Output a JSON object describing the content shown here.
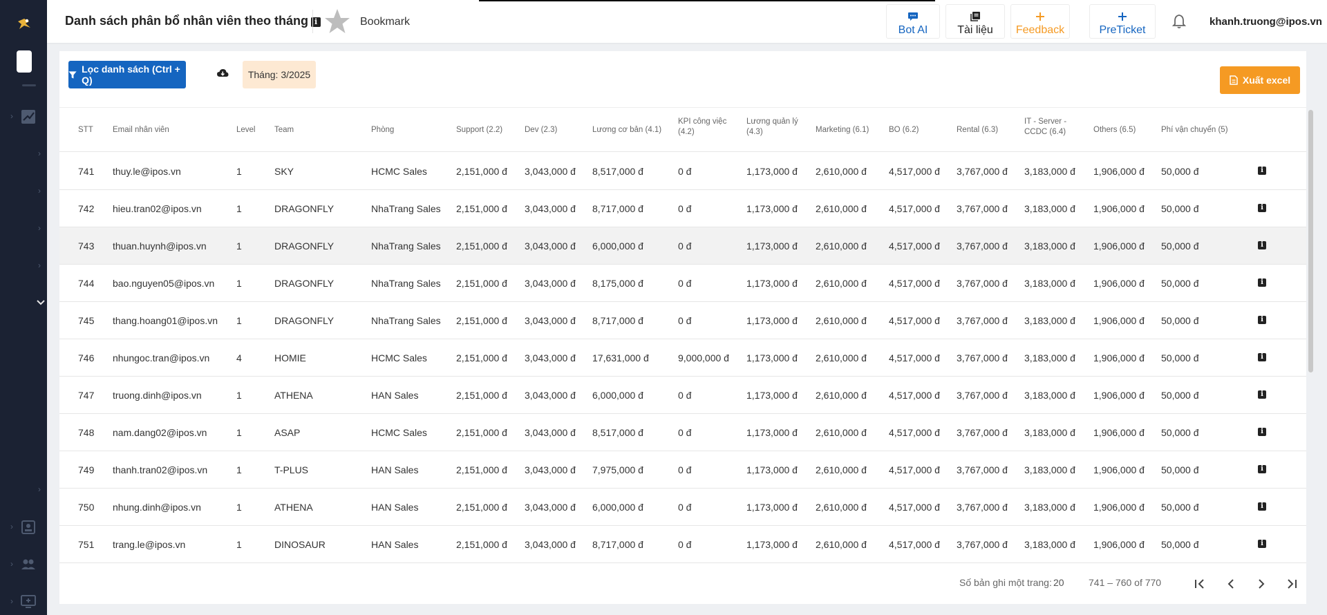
{
  "header": {
    "title": "Danh sách phân bổ nhân viên theo tháng",
    "info_glyph": "i",
    "bookmark_label": "Bookmark",
    "buttons": [
      {
        "label": "Bot AI",
        "icon": "chat-icon",
        "color": "#1565c0"
      },
      {
        "label": "Tài liệu",
        "icon": "library-icon",
        "color": "#222222"
      },
      {
        "label": "Feedback",
        "icon": "plus-icon",
        "color": "#f59a23"
      },
      {
        "label": "PreTicket",
        "icon": "plus-icon",
        "color": "#1565c0"
      }
    ],
    "user": "khanh.truong@ipos.vn"
  },
  "toolbar": {
    "filter_label": "Lọc danh sách (Ctrl + Q)",
    "month_label": "Tháng: 3/2025",
    "export_label": "Xuất excel"
  },
  "colors": {
    "sidebar": "#1b2233",
    "primary": "#1565c0",
    "accent": "#f59a23",
    "chip": "#fde9d3"
  },
  "table": {
    "columns": [
      "STT",
      "Email nhân viên",
      "Level",
      "Team",
      "Phòng",
      "Support (2.2)",
      "Dev (2.3)",
      "Lương cơ bản (4.1)",
      [
        "KPI công việc",
        "(4.2)"
      ],
      [
        "Lương quản lý",
        "(4.3)"
      ],
      "Marketing (6.1)",
      "BO (6.2)",
      "Rental (6.3)",
      [
        "IT - Server -",
        "CCDC (6.4)"
      ],
      "Others (6.5)",
      "Phí vận chuyển (5)"
    ],
    "rows": [
      [
        "741",
        "thuy.le@ipos.vn",
        "1",
        "SKY",
        "HCMC Sales",
        "2,151,000 đ",
        "3,043,000 đ",
        "8,517,000 đ",
        "0 đ",
        "1,173,000 đ",
        "2,610,000 đ",
        "4,517,000 đ",
        "3,767,000 đ",
        "3,183,000 đ",
        "1,906,000 đ",
        "50,000 đ"
      ],
      [
        "742",
        "hieu.tran02@ipos.vn",
        "1",
        "DRAGONFLY",
        "NhaTrang Sales",
        "2,151,000 đ",
        "3,043,000 đ",
        "8,717,000 đ",
        "0 đ",
        "1,173,000 đ",
        "2,610,000 đ",
        "4,517,000 đ",
        "3,767,000 đ",
        "3,183,000 đ",
        "1,906,000 đ",
        "50,000 đ"
      ],
      [
        "743",
        "thuan.huynh@ipos.vn",
        "1",
        "DRAGONFLY",
        "NhaTrang Sales",
        "2,151,000 đ",
        "3,043,000 đ",
        "6,000,000 đ",
        "0 đ",
        "1,173,000 đ",
        "2,610,000 đ",
        "4,517,000 đ",
        "3,767,000 đ",
        "3,183,000 đ",
        "1,906,000 đ",
        "50,000 đ"
      ],
      [
        "744",
        "bao.nguyen05@ipos.vn",
        "1",
        "DRAGONFLY",
        "NhaTrang Sales",
        "2,151,000 đ",
        "3,043,000 đ",
        "8,175,000 đ",
        "0 đ",
        "1,173,000 đ",
        "2,610,000 đ",
        "4,517,000 đ",
        "3,767,000 đ",
        "3,183,000 đ",
        "1,906,000 đ",
        "50,000 đ"
      ],
      [
        "745",
        "thang.hoang01@ipos.vn",
        "1",
        "DRAGONFLY",
        "NhaTrang Sales",
        "2,151,000 đ",
        "3,043,000 đ",
        "8,717,000 đ",
        "0 đ",
        "1,173,000 đ",
        "2,610,000 đ",
        "4,517,000 đ",
        "3,767,000 đ",
        "3,183,000 đ",
        "1,906,000 đ",
        "50,000 đ"
      ],
      [
        "746",
        "nhungoc.tran@ipos.vn",
        "4",
        "HOMIE",
        "HCMC Sales",
        "2,151,000 đ",
        "3,043,000 đ",
        "17,631,000 đ",
        "9,000,000 đ",
        "1,173,000 đ",
        "2,610,000 đ",
        "4,517,000 đ",
        "3,767,000 đ",
        "3,183,000 đ",
        "1,906,000 đ",
        "50,000 đ"
      ],
      [
        "747",
        "truong.dinh@ipos.vn",
        "1",
        "ATHENA",
        "HAN Sales",
        "2,151,000 đ",
        "3,043,000 đ",
        "6,000,000 đ",
        "0 đ",
        "1,173,000 đ",
        "2,610,000 đ",
        "4,517,000 đ",
        "3,767,000 đ",
        "3,183,000 đ",
        "1,906,000 đ",
        "50,000 đ"
      ],
      [
        "748",
        "nam.dang02@ipos.vn",
        "1",
        "ASAP",
        "HCMC Sales",
        "2,151,000 đ",
        "3,043,000 đ",
        "8,517,000 đ",
        "0 đ",
        "1,173,000 đ",
        "2,610,000 đ",
        "4,517,000 đ",
        "3,767,000 đ",
        "3,183,000 đ",
        "1,906,000 đ",
        "50,000 đ"
      ],
      [
        "749",
        "thanh.tran02@ipos.vn",
        "1",
        "T-PLUS",
        "HAN Sales",
        "2,151,000 đ",
        "3,043,000 đ",
        "7,975,000 đ",
        "0 đ",
        "1,173,000 đ",
        "2,610,000 đ",
        "4,517,000 đ",
        "3,767,000 đ",
        "3,183,000 đ",
        "1,906,000 đ",
        "50,000 đ"
      ],
      [
        "750",
        "nhung.dinh@ipos.vn",
        "1",
        "ATHENA",
        "HAN Sales",
        "2,151,000 đ",
        "3,043,000 đ",
        "6,000,000 đ",
        "0 đ",
        "1,173,000 đ",
        "2,610,000 đ",
        "4,517,000 đ",
        "3,767,000 đ",
        "3,183,000 đ",
        "1,906,000 đ",
        "50,000 đ"
      ],
      [
        "751",
        "trang.le@ipos.vn",
        "1",
        "DINOSAUR",
        "HAN Sales",
        "2,151,000 đ",
        "3,043,000 đ",
        "8,717,000 đ",
        "0 đ",
        "1,173,000 đ",
        "2,610,000 đ",
        "4,517,000 đ",
        "3,767,000 đ",
        "3,183,000 đ",
        "1,906,000 đ",
        "50,000 đ"
      ]
    ],
    "highlighted_row": 2
  },
  "pager": {
    "per_page_label": "Số bản ghi một trang:",
    "per_page_value": "20",
    "range": "741 – 760 of 770"
  }
}
